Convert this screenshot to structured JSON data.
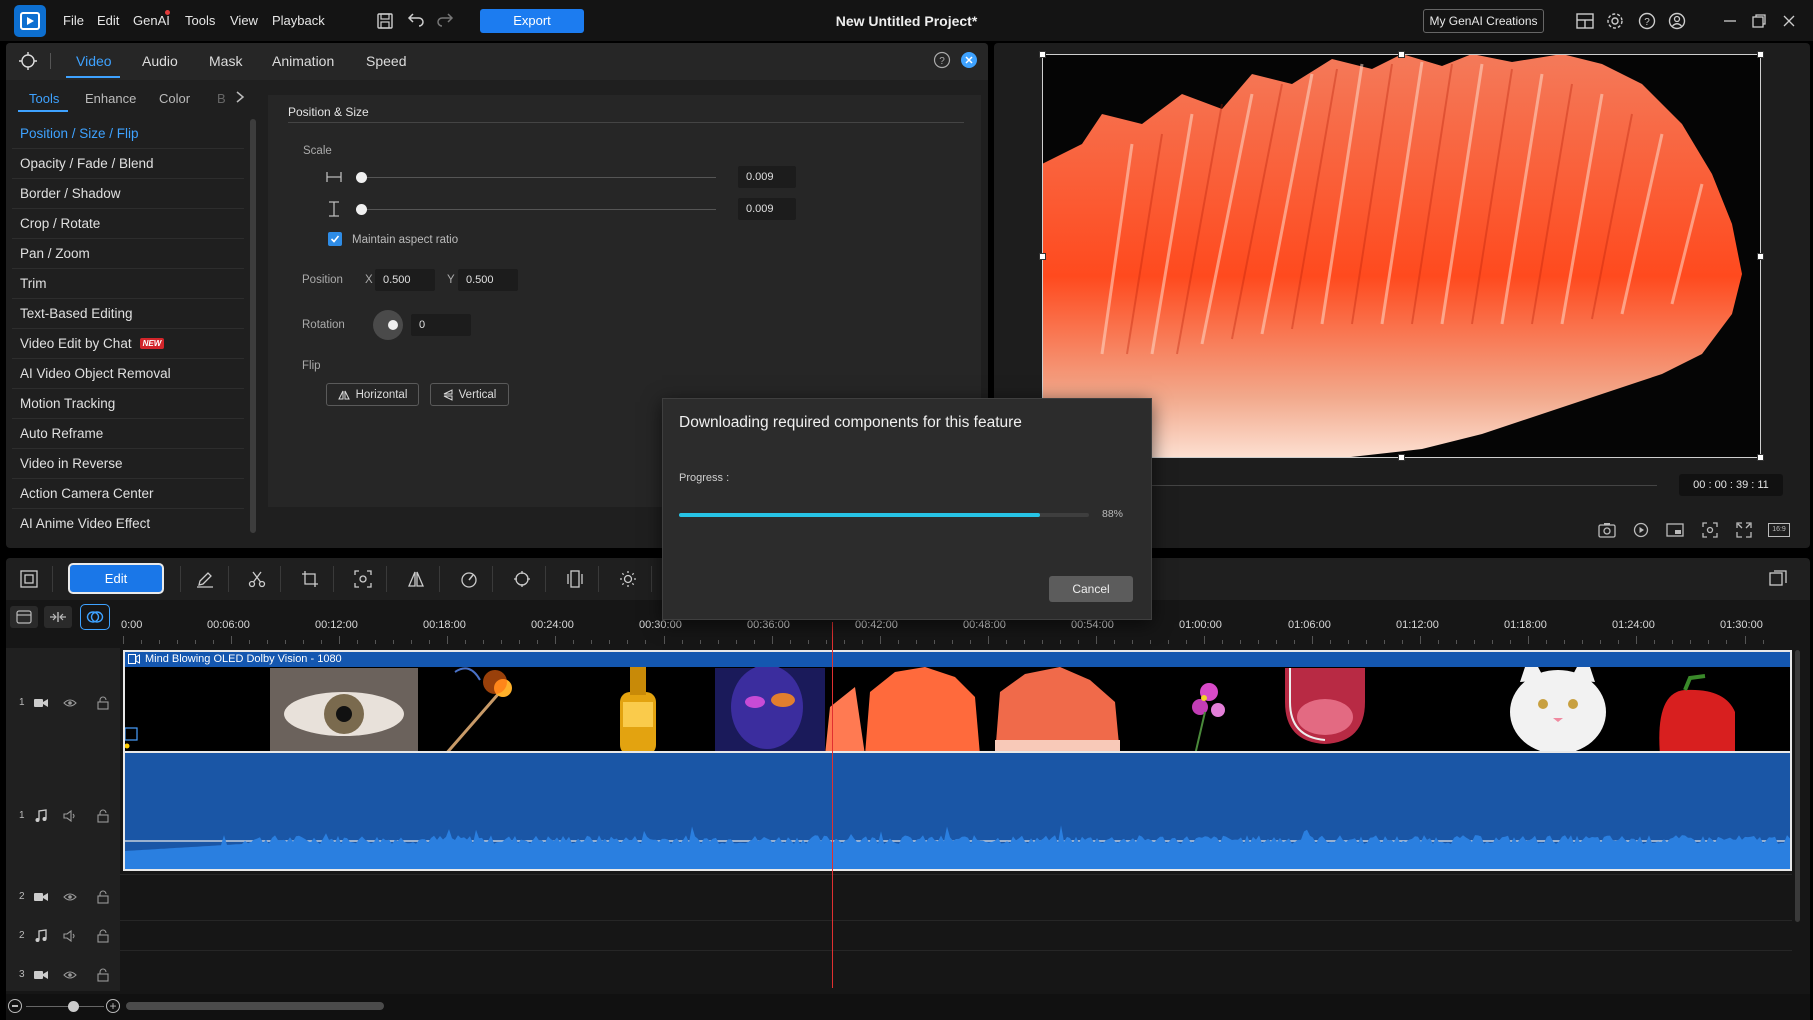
{
  "app": {
    "title": "New Untitled Project*",
    "menu": [
      "File",
      "Edit",
      "GenAI",
      "Tools",
      "View",
      "Playback"
    ],
    "export_label": "Export",
    "my_genai_label": "My GenAI Creations"
  },
  "panel": {
    "tabs": [
      "Video",
      "Audio",
      "Mask",
      "Animation",
      "Speed"
    ],
    "active_tab": "Video",
    "subtabs": [
      "Tools",
      "Enhance",
      "Color",
      "B"
    ],
    "active_subtab": "Tools",
    "tools": [
      {
        "label": "Position / Size / Flip",
        "active": true
      },
      {
        "label": "Opacity / Fade / Blend"
      },
      {
        "label": "Border / Shadow"
      },
      {
        "label": "Crop / Rotate"
      },
      {
        "label": "Pan / Zoom"
      },
      {
        "label": "Trim"
      },
      {
        "label": "Text-Based Editing"
      },
      {
        "label": "Video Edit by Chat",
        "badge": "NEW"
      },
      {
        "label": "AI Video Object Removal"
      },
      {
        "label": "Motion Tracking"
      },
      {
        "label": "Auto Reframe"
      },
      {
        "label": "Video in Reverse"
      },
      {
        "label": "Action Camera Center"
      },
      {
        "label": "AI Anime Video Effect"
      }
    ]
  },
  "position_size": {
    "section_title": "Position & Size",
    "scale_label": "Scale",
    "scale_width": "0.009",
    "scale_height": "0.009",
    "maintain_aspect_label": "Maintain aspect ratio",
    "maintain_aspect_checked": true,
    "position_label": "Position",
    "x_label": "X",
    "x_value": "0.500",
    "y_label": "Y",
    "y_value": "0.500",
    "rotation_label": "Rotation",
    "rotation_value": "0",
    "flip_label": "Flip",
    "flip_horizontal": "Horizontal",
    "flip_vertical": "Vertical"
  },
  "preview": {
    "timecode": "00 : 00 : 39 : 11",
    "aspect_badge": "16:9"
  },
  "toolbar": {
    "edit_label": "Edit"
  },
  "timeline": {
    "ruler_labels": [
      "0:00",
      "00:06:00",
      "00:12:00",
      "00:18:00",
      "00:24:00",
      "00:30:00",
      "00:36:00",
      "00:42:00",
      "00:48:00",
      "00:54:00",
      "01:00:00",
      "01:06:00",
      "01:12:00",
      "01:18:00",
      "01:24:00",
      "01:30:00"
    ],
    "clip_title": "Mind Blowing OLED Dolby Vision - 1080",
    "tracks": [
      {
        "num": "1",
        "kind": "video"
      },
      {
        "num": "1",
        "kind": "audio"
      },
      {
        "num": "2",
        "kind": "video"
      },
      {
        "num": "2",
        "kind": "audio"
      },
      {
        "num": "3",
        "kind": "video"
      }
    ]
  },
  "dialog": {
    "title": "Downloading required components for this feature",
    "progress_label": "Progress :",
    "progress_percent": 88,
    "progress_text": "88%",
    "cancel_label": "Cancel"
  },
  "colors": {
    "accent": "#3ea2ff",
    "export": "#1c7cf0",
    "progress": "#27c4e6",
    "audio_clip": "#1a56a6",
    "playhead": "#e03030"
  }
}
